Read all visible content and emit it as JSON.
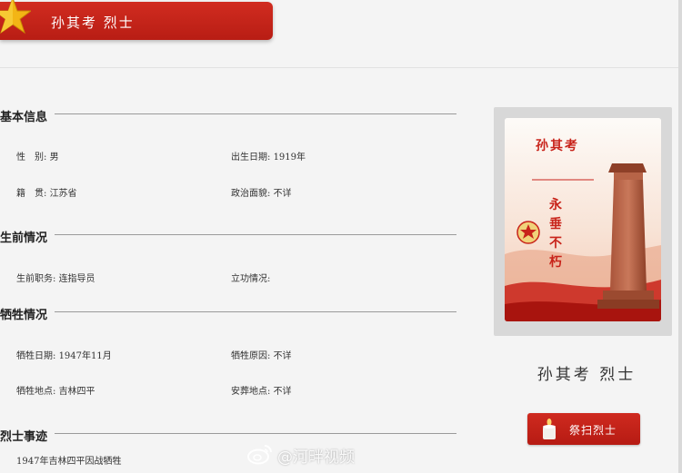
{
  "header": {
    "title": "孙其考 烈士"
  },
  "sections": {
    "basic": {
      "title": "基本信息",
      "gender_label": "性　别:",
      "gender_value": "男",
      "birth_label": "出生日期:",
      "birth_value": "1919年",
      "origin_label": "籍　贯:",
      "origin_value": "江苏省",
      "political_label": "政治面貌:",
      "political_value": "不详"
    },
    "life": {
      "title": "生前情况",
      "position_label": "生前职务:",
      "position_value": "连指导员",
      "merit_label": "立功情况:",
      "merit_value": ""
    },
    "sacrifice": {
      "title": "牺牲情况",
      "date_label": "牺牲日期:",
      "date_value": "1947年11月",
      "reason_label": "牺牲原因:",
      "reason_value": "不详",
      "place_label": "牺牲地点:",
      "place_value": "吉林四平",
      "burial_label": "安葬地点:",
      "burial_value": "不详"
    },
    "deeds": {
      "title": "烈士事迹",
      "text": "1947年吉林四平因战牺牲"
    }
  },
  "card": {
    "name": "孙其考",
    "motto": [
      "永",
      "垂",
      "不",
      "朽"
    ]
  },
  "profile": {
    "name": "孙其考 烈士"
  },
  "tribute_button": {
    "label": "祭扫烈士"
  },
  "watermark": {
    "text": "@河畔视频"
  },
  "colors": {
    "accent": "#c4241a",
    "background": "#f4f4f4"
  }
}
